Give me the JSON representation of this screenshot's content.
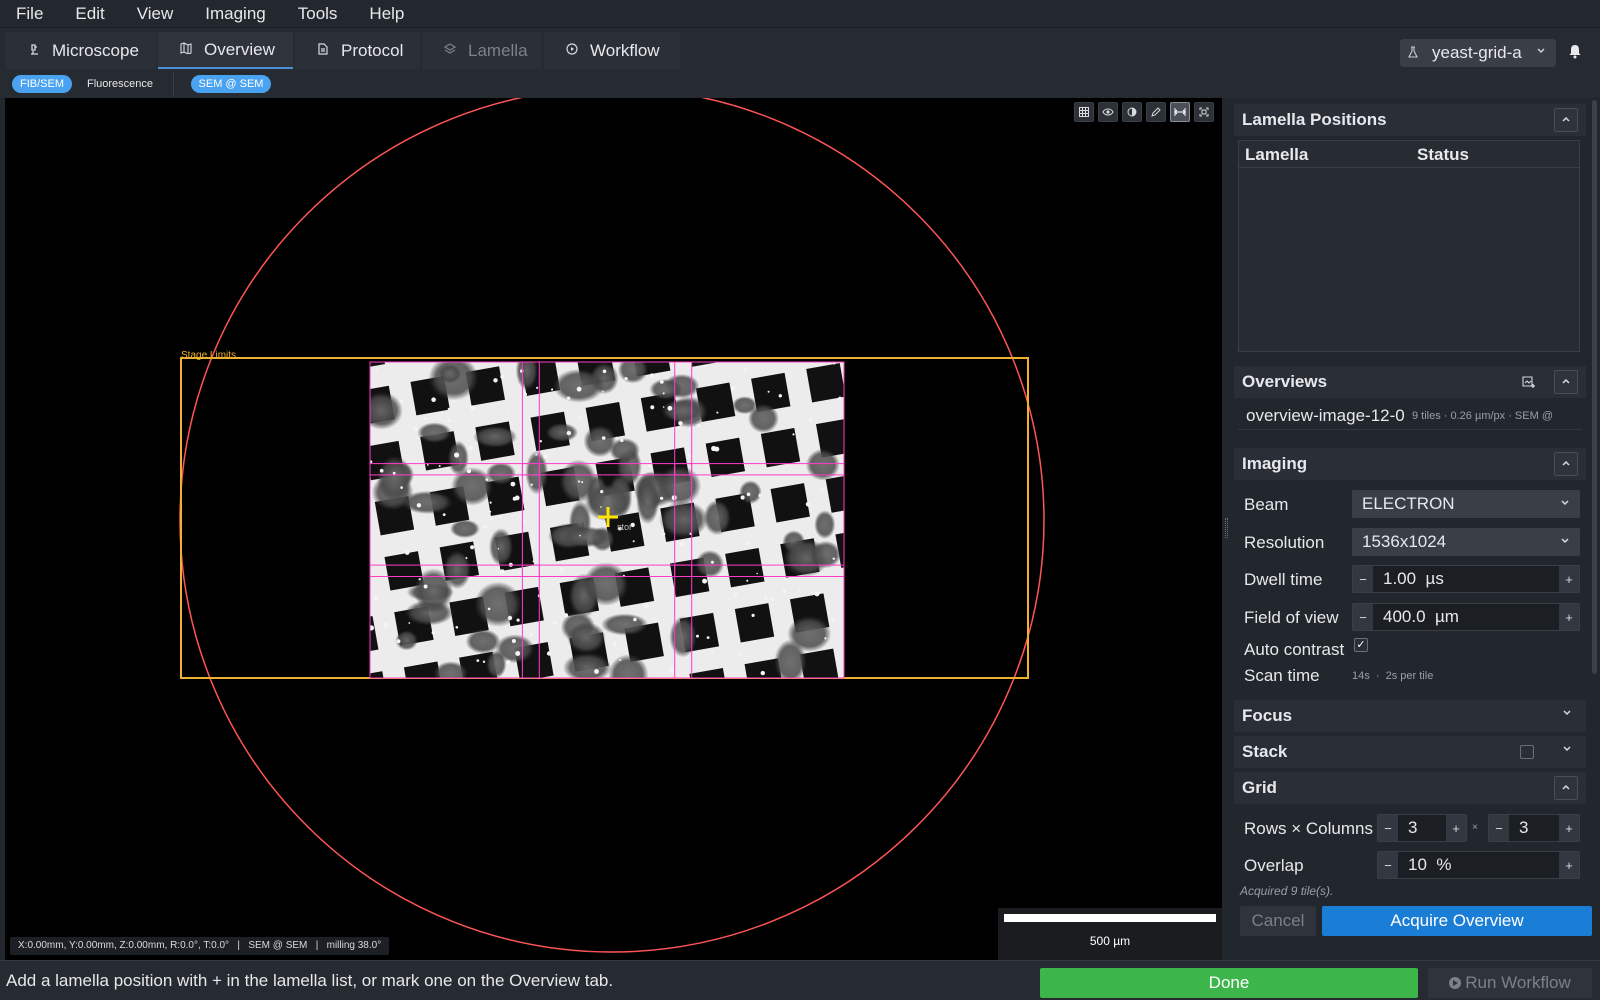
{
  "menu": [
    "File",
    "Edit",
    "View",
    "Imaging",
    "Tools",
    "Help"
  ],
  "tabs": [
    {
      "label": "Microscope",
      "icon": "microscope-icon",
      "state": "normal"
    },
    {
      "label": "Overview",
      "icon": "map-icon",
      "state": "active"
    },
    {
      "label": "Protocol",
      "icon": "document-icon",
      "state": "normal"
    },
    {
      "label": "Lamella",
      "icon": "layers-icon",
      "state": "disabled"
    },
    {
      "label": "Workflow",
      "icon": "play-circle-icon",
      "state": "normal"
    }
  ],
  "project": {
    "name": "yeast-grid-a",
    "icon": "flask-icon"
  },
  "modes": {
    "fibsem": "FIB/SEM",
    "fluorescence": "Fluorescence",
    "beam_pill": "SEM @ SEM"
  },
  "viewer": {
    "stage_limits_label": "Stage Limits",
    "coords": "X:0.00mm, Y:0.00mm, Z:0.00mm, R:0.0°, T:0.0°   |   SEM @ SEM   |   milling 38.0°",
    "scalebar": "500 µm",
    "overview_label": "stor",
    "tools": [
      "grid-icon",
      "eye-icon",
      "contrast-icon",
      "pencil-icon",
      "measure-icon",
      "fit-icon"
    ],
    "active_tool": "measure-icon"
  },
  "panel": {
    "lamella": {
      "title": "Lamella Positions",
      "col_lamella": "Lamella",
      "col_status": "Status",
      "rows": []
    },
    "overviews": {
      "title": "Overviews",
      "item_name": "overview-image-12-0",
      "item_meta": "9 tiles · 0.26 µm/px · SEM @"
    },
    "imaging": {
      "title": "Imaging",
      "beam_label": "Beam",
      "beam_value": "ELECTRON",
      "resolution_label": "Resolution",
      "resolution_value": "1536x1024",
      "dwell_label": "Dwell time",
      "dwell_value": "1.00  µs",
      "fov_label": "Field of view",
      "fov_value": "400.0  µm",
      "auto_contrast_label": "Auto contrast",
      "auto_contrast": true,
      "scan_time_label": "Scan time",
      "scan_time_value": "14s  ·  2s per tile"
    },
    "focus": {
      "title": "Focus"
    },
    "stack": {
      "title": "Stack",
      "enabled": false
    },
    "grid": {
      "title": "Grid",
      "rows_cols_label": "Rows × Columns",
      "rows": "3",
      "cols": "3",
      "times": "×",
      "overlap_label": "Overlap",
      "overlap_value": "10  %"
    },
    "acquired_note": "Acquired 9 tile(s).",
    "cancel_label": "Cancel",
    "acquire_label": "Acquire Overview"
  },
  "status": {
    "message": "Add a lamella position with + in the lamella list, or mark one on the Overview tab.",
    "done_label": "Done",
    "run_label": "Run Workflow"
  },
  "colors": {
    "accent": "#4aa3f0",
    "primary_button": "#1a7ed6",
    "done_button": "#3cb54a",
    "stage_limits": "#f0b030",
    "reachable_circle": "#ff5555",
    "tile_grid": "#ff3cc8",
    "stage_marker": "#ffe600"
  }
}
